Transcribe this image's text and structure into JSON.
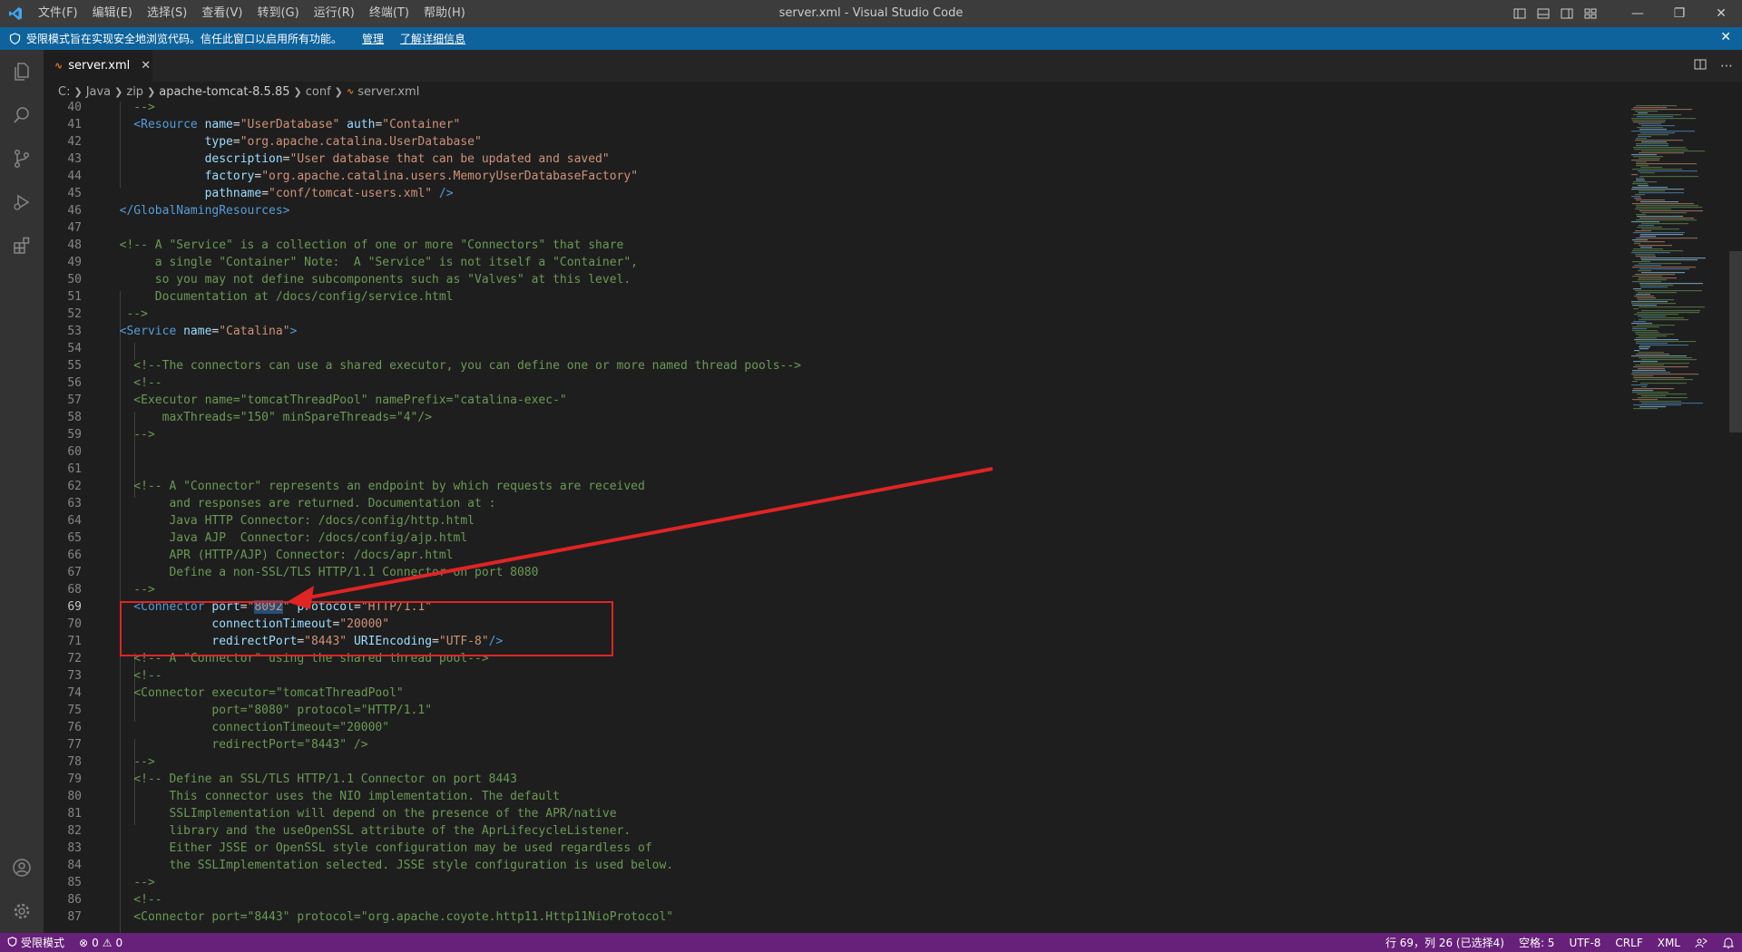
{
  "window": {
    "title": "server.xml - Visual Studio Code"
  },
  "menu": [
    "文件(F)",
    "编辑(E)",
    "选择(S)",
    "查看(V)",
    "转到(G)",
    "运行(R)",
    "终端(T)",
    "帮助(H)"
  ],
  "banner": {
    "message": "受限模式旨在实现安全地浏览代码。信任此窗口以启用所有功能。",
    "manage": "管理",
    "learn_more": "了解详细信息"
  },
  "tab": {
    "label": "server.xml",
    "icon": "xml-icon"
  },
  "breadcrumb": [
    "C:",
    "Java",
    "zip",
    "apache-tomcat-8.5.85",
    "conf",
    "server.xml"
  ],
  "editor": {
    "lines": [
      {
        "n": "40",
        "t": [
          [
            "com",
            "    -->"
          ]
        ]
      },
      {
        "n": "41",
        "t": [
          [
            "tag",
            "    <Resource"
          ],
          [
            "txt",
            " "
          ],
          [
            "attr",
            "name"
          ],
          [
            "txt",
            "="
          ],
          [
            "str",
            "\"UserDatabase\""
          ],
          [
            "txt",
            " "
          ],
          [
            "attr",
            "auth"
          ],
          [
            "txt",
            "="
          ],
          [
            "str",
            "\"Container\""
          ]
        ]
      },
      {
        "n": "42",
        "t": [
          [
            "txt",
            "              "
          ],
          [
            "attr",
            "type"
          ],
          [
            "txt",
            "="
          ],
          [
            "str",
            "\"org.apache.catalina.UserDatabase\""
          ]
        ]
      },
      {
        "n": "43",
        "t": [
          [
            "txt",
            "              "
          ],
          [
            "attr",
            "description"
          ],
          [
            "txt",
            "="
          ],
          [
            "str",
            "\"User database that can be updated and saved\""
          ]
        ]
      },
      {
        "n": "44",
        "t": [
          [
            "txt",
            "              "
          ],
          [
            "attr",
            "factory"
          ],
          [
            "txt",
            "="
          ],
          [
            "str",
            "\"org.apache.catalina.users.MemoryUserDatabaseFactory\""
          ]
        ]
      },
      {
        "n": "45",
        "t": [
          [
            "txt",
            "              "
          ],
          [
            "attr",
            "pathname"
          ],
          [
            "txt",
            "="
          ],
          [
            "str",
            "\"conf/tomcat-users.xml\""
          ],
          [
            "tag",
            " />"
          ]
        ]
      },
      {
        "n": "46",
        "t": [
          [
            "tag",
            "  </GlobalNamingResources>"
          ]
        ]
      },
      {
        "n": "47",
        "t": []
      },
      {
        "n": "48",
        "t": [
          [
            "com",
            "  <!-- A \"Service\" is a collection of one or more \"Connectors\" that share"
          ]
        ]
      },
      {
        "n": "49",
        "t": [
          [
            "com",
            "       a single \"Container\" Note:  A \"Service\" is not itself a \"Container\","
          ]
        ]
      },
      {
        "n": "50",
        "t": [
          [
            "com",
            "       so you may not define subcomponents such as \"Valves\" at this level."
          ]
        ]
      },
      {
        "n": "51",
        "t": [
          [
            "com",
            "       Documentation at /docs/config/service.html"
          ]
        ]
      },
      {
        "n": "52",
        "t": [
          [
            "com",
            "   -->"
          ]
        ]
      },
      {
        "n": "53",
        "t": [
          [
            "tag",
            "  <Service"
          ],
          [
            "txt",
            " "
          ],
          [
            "attr",
            "name"
          ],
          [
            "txt",
            "="
          ],
          [
            "str",
            "\"Catalina\""
          ],
          [
            "tag",
            ">"
          ]
        ]
      },
      {
        "n": "54",
        "t": []
      },
      {
        "n": "55",
        "t": [
          [
            "com",
            "    <!--The connectors can use a shared executor, you can define one or more named thread pools-->"
          ]
        ]
      },
      {
        "n": "56",
        "t": [
          [
            "com",
            "    <!--"
          ]
        ]
      },
      {
        "n": "57",
        "t": [
          [
            "com",
            "    <Executor name=\"tomcatThreadPool\" namePrefix=\"catalina-exec-\""
          ]
        ]
      },
      {
        "n": "58",
        "t": [
          [
            "com",
            "        maxThreads=\"150\" minSpareThreads=\"4\"/>"
          ]
        ]
      },
      {
        "n": "59",
        "t": [
          [
            "com",
            "    -->"
          ]
        ]
      },
      {
        "n": "60",
        "t": []
      },
      {
        "n": "61",
        "t": []
      },
      {
        "n": "62",
        "t": [
          [
            "com",
            "    <!-- A \"Connector\" represents an endpoint by which requests are received"
          ]
        ]
      },
      {
        "n": "63",
        "t": [
          [
            "com",
            "         and responses are returned. Documentation at :"
          ]
        ]
      },
      {
        "n": "64",
        "t": [
          [
            "com",
            "         Java HTTP Connector: /docs/config/http.html"
          ]
        ]
      },
      {
        "n": "65",
        "t": [
          [
            "com",
            "         Java AJP  Connector: /docs/config/ajp.html"
          ]
        ]
      },
      {
        "n": "66",
        "t": [
          [
            "com",
            "         APR (HTTP/AJP) Connector: /docs/apr.html"
          ]
        ]
      },
      {
        "n": "67",
        "t": [
          [
            "com",
            "         Define a non-SSL/TLS HTTP/1.1 Connector on port 8080"
          ]
        ]
      },
      {
        "n": "68",
        "t": [
          [
            "com",
            "    -->"
          ]
        ]
      },
      {
        "n": "69",
        "t": [
          [
            "tag",
            "    <Connector"
          ],
          [
            "txt",
            " "
          ],
          [
            "attr",
            "port"
          ],
          [
            "txt",
            "="
          ],
          [
            "str",
            "\""
          ],
          [
            "sel",
            "8092"
          ],
          [
            "str",
            "\""
          ],
          [
            "txt",
            " "
          ],
          [
            "attr",
            "protocol"
          ],
          [
            "txt",
            "="
          ],
          [
            "str",
            "\"HTTP/1.1\""
          ]
        ]
      },
      {
        "n": "70",
        "t": [
          [
            "txt",
            "               "
          ],
          [
            "attr",
            "connectionTimeout"
          ],
          [
            "txt",
            "="
          ],
          [
            "str",
            "\"20000\""
          ]
        ]
      },
      {
        "n": "71",
        "t": [
          [
            "txt",
            "               "
          ],
          [
            "attr",
            "redirectPort"
          ],
          [
            "txt",
            "="
          ],
          [
            "str",
            "\"8443\""
          ],
          [
            "txt",
            " "
          ],
          [
            "attr",
            "URIEncoding"
          ],
          [
            "txt",
            "="
          ],
          [
            "str",
            "\"UTF-8\""
          ],
          [
            "tag",
            "/>"
          ]
        ]
      },
      {
        "n": "72",
        "t": [
          [
            "com",
            "    <!-- A \"Connector\" using the shared thread pool-->"
          ]
        ]
      },
      {
        "n": "73",
        "t": [
          [
            "com",
            "    <!--"
          ]
        ]
      },
      {
        "n": "74",
        "t": [
          [
            "com",
            "    <Connector executor=\"tomcatThreadPool\""
          ]
        ]
      },
      {
        "n": "75",
        "t": [
          [
            "com",
            "               port=\"8080\" protocol=\"HTTP/1.1\""
          ]
        ]
      },
      {
        "n": "76",
        "t": [
          [
            "com",
            "               connectionTimeout=\"20000\""
          ]
        ]
      },
      {
        "n": "77",
        "t": [
          [
            "com",
            "               redirectPort=\"8443\" />"
          ]
        ]
      },
      {
        "n": "78",
        "t": [
          [
            "com",
            "    -->"
          ]
        ]
      },
      {
        "n": "79",
        "t": [
          [
            "com",
            "    <!-- Define an SSL/TLS HTTP/1.1 Connector on port 8443"
          ]
        ]
      },
      {
        "n": "80",
        "t": [
          [
            "com",
            "         This connector uses the NIO implementation. The default"
          ]
        ]
      },
      {
        "n": "81",
        "t": [
          [
            "com",
            "         SSLImplementation will depend on the presence of the APR/native"
          ]
        ]
      },
      {
        "n": "82",
        "t": [
          [
            "com",
            "         library and the useOpenSSL attribute of the AprLifecycleListener."
          ]
        ]
      },
      {
        "n": "83",
        "t": [
          [
            "com",
            "         Either JSSE or OpenSSL style configuration may be used regardless of"
          ]
        ]
      },
      {
        "n": "84",
        "t": [
          [
            "com",
            "         the SSLImplementation selected. JSSE style configuration is used below."
          ]
        ]
      },
      {
        "n": "85",
        "t": [
          [
            "com",
            "    -->"
          ]
        ]
      },
      {
        "n": "86",
        "t": [
          [
            "com",
            "    <!--"
          ]
        ]
      },
      {
        "n": "87",
        "t": [
          [
            "com",
            "    <Connector port=\"8443\" protocol=\"org.apache.coyote.http11.Http11NioProtocol\""
          ]
        ]
      }
    ],
    "current_line": "69"
  },
  "status": {
    "restricted": "受限模式",
    "errors": "0",
    "warnings": "0",
    "position": "行 69，列 26 (已选择4)",
    "spaces": "空格: 5",
    "encoding": "UTF-8",
    "eol": "CRLF",
    "language": "XML"
  },
  "colors": {
    "titlebar": "#3c3c3c",
    "banner": "#0e639c",
    "statusbar": "#68217a",
    "editor_bg": "#1e1e1e",
    "annotation_red": "#e02424"
  }
}
